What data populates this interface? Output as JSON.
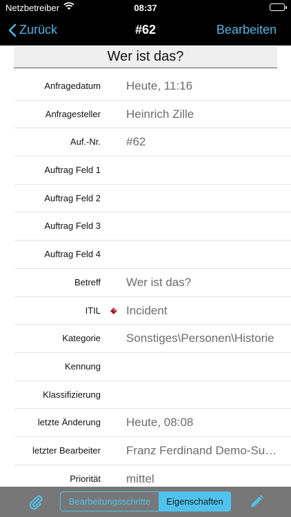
{
  "status_bar": {
    "carrier": "Netzbetreiber",
    "time": "08:37",
    "battery_level": 1.0
  },
  "nav": {
    "back_label": "Zurück",
    "title": "#62",
    "edit_label": "Bearbeiten"
  },
  "ticket_title": "Wer ist das?",
  "fields": [
    {
      "label": "Anfragedatum",
      "value": "Heute, 11:16"
    },
    {
      "label": "Anfragesteller",
      "value": "Heinrich Zille"
    },
    {
      "label": "Auf.-Nr.",
      "value": "#62"
    },
    {
      "label": "Auftrag Feld 1",
      "value": ""
    },
    {
      "label": "Auftrag Feld 2",
      "value": ""
    },
    {
      "label": "Auftrag Feld 3",
      "value": ""
    },
    {
      "label": "Auftrag Feld 4",
      "value": ""
    },
    {
      "label": "Betreff",
      "value": "Wer ist das?"
    },
    {
      "label": "ITIL",
      "value": "Incident",
      "icon": "incident-diamond-icon"
    },
    {
      "label": "Kategorie",
      "value": "Sonstiges\\Personen\\Historie"
    },
    {
      "label": "Kennung",
      "value": ""
    },
    {
      "label": "Klassifizierung",
      "value": ""
    },
    {
      "label": "letzte Änderung",
      "value": "Heute, 08:08"
    },
    {
      "label": "letzter Bearbeiter",
      "value": "Franz Ferdinand Demo-Support"
    },
    {
      "label": "Priorität",
      "value": "mittel"
    }
  ],
  "toolbar": {
    "segments": [
      "Bearbeitungsschritte",
      "Eigenschaften"
    ],
    "selected_segment": "Eigenschaften",
    "attach_icon": "paperclip-icon",
    "edit_icon": "pencil-icon"
  },
  "colors": {
    "accent": "#4fc3ee",
    "nav_background": "#000000",
    "toolbar_background": "#777777",
    "value_text": "#6c6c6c"
  }
}
